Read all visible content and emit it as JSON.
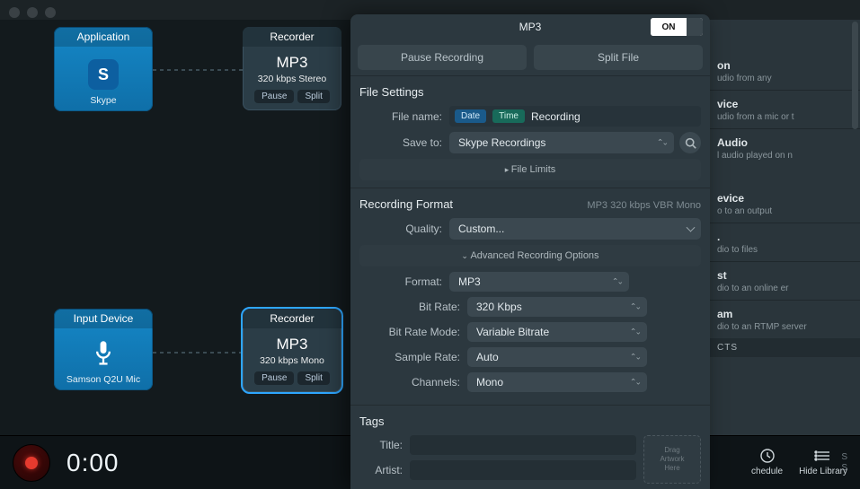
{
  "nodes": {
    "app": {
      "head": "Application",
      "label": "Skype",
      "iconLetter": "S"
    },
    "rec1": {
      "head": "Recorder",
      "format": "MP3",
      "detail": "320 kbps Stereo",
      "pause": "Pause",
      "split": "Split"
    },
    "input": {
      "head": "Input Device",
      "label": "Samson Q2U Mic"
    },
    "rec2": {
      "head": "Recorder",
      "format": "MP3",
      "detail": "320 kbps Mono",
      "pause": "Pause",
      "split": "Split"
    }
  },
  "bottom": {
    "time": "0:00",
    "cut1": "S",
    "cut2": "S"
  },
  "panel": {
    "title": "MP3",
    "toggle": "ON",
    "pauseBtn": "Pause Recording",
    "splitBtn": "Split File",
    "fileSettings": "File Settings",
    "fileNameLabel": "File name:",
    "pillDate": "Date",
    "pillTime": "Time",
    "fileNameValue": "Recording",
    "saveToLabel": "Save to:",
    "saveToValue": "Skype Recordings",
    "fileLimits": "File Limits",
    "recFormat": "Recording Format",
    "recFormatHint": "MP3 320 kbps VBR Mono",
    "qualityLabel": "Quality:",
    "qualityValue": "Custom...",
    "advOpts": "Advanced Recording Options",
    "formatLabel": "Format:",
    "formatValue": "MP3",
    "bitrateLabel": "Bit Rate:",
    "bitrateValue": "320 Kbps",
    "brmodeLabel": "Bit Rate Mode:",
    "brmodeValue": "Variable Bitrate",
    "samplerateLabel": "Sample Rate:",
    "samplerateValue": "Auto",
    "channelsLabel": "Channels:",
    "channelsValue": "Mono",
    "tags": "Tags",
    "titleLabel": "Title:",
    "artistLabel": "Artist:",
    "dragArt": "Drag\nArtwork\nHere"
  },
  "right": {
    "items": [
      {
        "title": "on",
        "desc": "udio from any"
      },
      {
        "title": "vice",
        "desc": "udio from a mic or\nt"
      },
      {
        "title": "Audio",
        "desc": "l audio played on\nn"
      },
      {
        "title": "evice",
        "desc": "o to an output"
      },
      {
        "title": ".",
        "desc": "dio to files"
      },
      {
        "title": "st",
        "desc": "dio to an online\ner"
      },
      {
        "title": "am",
        "desc": "dio to an RTMP server"
      }
    ],
    "sectionHead": "CTS",
    "schedule": "chedule",
    "hideLib": "Hide Library"
  }
}
